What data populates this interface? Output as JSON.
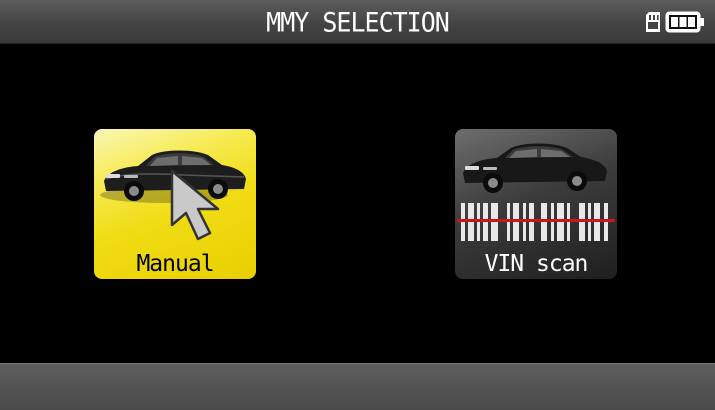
{
  "header": {
    "title": "MMY SELECTION",
    "status_icons": [
      "sd-card-icon",
      "battery-icon"
    ]
  },
  "options": [
    {
      "label": "Manual",
      "icon": "car-with-cursor-icon",
      "selected": true,
      "accent": "#f2dc1e"
    },
    {
      "label": "VIN scan",
      "icon": "car-with-barcode-icon",
      "selected": false,
      "accent": "#3c3c3c"
    }
  ],
  "colors": {
    "background": "#000000",
    "bar": "#4a4a4a",
    "barcode_line": "#d0141a"
  }
}
